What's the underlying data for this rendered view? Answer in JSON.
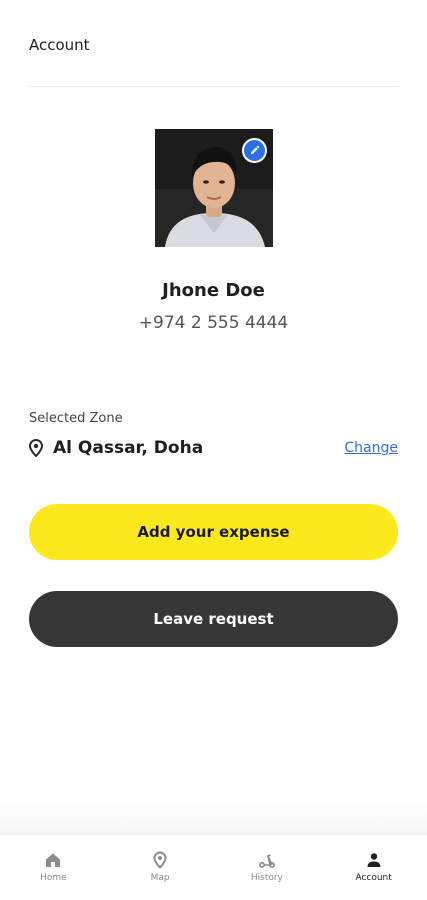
{
  "header": {
    "title": "Account"
  },
  "profile": {
    "name": "Jhone Doe",
    "phone": "+974 2 555 4444"
  },
  "zone": {
    "label": "Selected Zone",
    "value": "Al Qassar, Doha",
    "change_label": "Change"
  },
  "actions": {
    "expense_label": "Add your expense",
    "leave_label": "Leave request"
  },
  "tabs": [
    {
      "label": "Home",
      "icon": "home-icon"
    },
    {
      "label": "Map",
      "icon": "map-pin-icon"
    },
    {
      "label": "History",
      "icon": "scooter-icon"
    },
    {
      "label": "Account",
      "icon": "person-icon",
      "active": true
    }
  ],
  "colors": {
    "accent_yellow": "#fbe91d",
    "dark_button": "#363636",
    "link_blue": "#2f6fe4"
  }
}
